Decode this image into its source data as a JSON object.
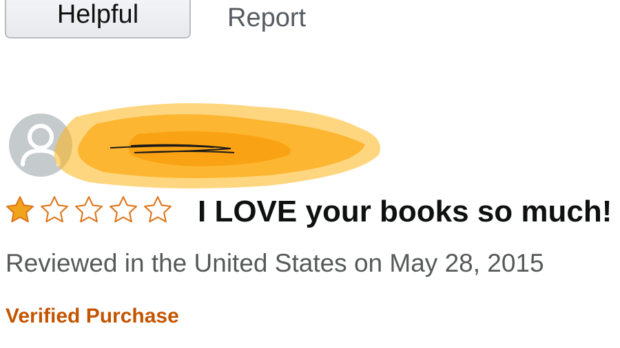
{
  "actions": {
    "helpful_label": "Helpful",
    "report_label": "Report"
  },
  "review": {
    "avatar_icon": "default-user-avatar-icon",
    "reviewer_name_redacted": true,
    "rating": 1,
    "rating_max": 5,
    "title": "I LOVE your books so much!",
    "meta": "Reviewed in the United States on May 28, 2015",
    "badge": "Verified Purchase"
  },
  "colors": {
    "star_filled": "#f0a41c",
    "star_outline": "#de7921",
    "verified": "#c45500",
    "redaction": "#fdb515",
    "avatar_bg": "#c5cacd"
  }
}
